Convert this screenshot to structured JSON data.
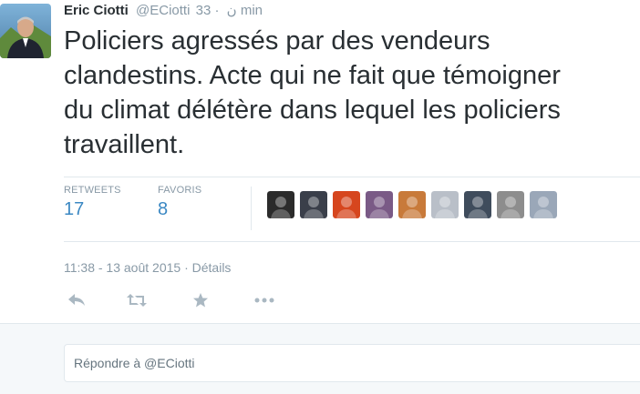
{
  "tweet": {
    "author_name": "Eric Ciotti",
    "author_handle": "@ECiotti",
    "handle_suffix": "ن",
    "time_ago": "· 33 min",
    "text_lines": [
      "Policiers agressés par des vendeurs",
      "clandestins. Acte qui ne fait que témoigner",
      "du climat délétère dans lequel les policiers",
      "travaillent."
    ]
  },
  "stats": {
    "retweets_label": "RETWEETS",
    "retweets_count": "17",
    "favorites_label": "FAVORIS",
    "favorites_count": "8"
  },
  "favoriters": [
    {
      "icon": "user-avatar",
      "color": "#2b2b2b"
    },
    {
      "icon": "user-avatar",
      "color": "#3a3f4a"
    },
    {
      "icon": "user-avatar",
      "color": "#d6461e"
    },
    {
      "icon": "user-avatar",
      "color": "#7a5a86"
    },
    {
      "icon": "user-avatar",
      "color": "#c87a3a"
    },
    {
      "icon": "user-avatar",
      "color": "#b9bfc8"
    },
    {
      "icon": "user-avatar",
      "color": "#3f4c5c"
    },
    {
      "icon": "user-avatar",
      "color": "#8d8d8d"
    },
    {
      "icon": "user-avatar",
      "color": "#9aa7b8"
    }
  ],
  "meta": {
    "timestamp": "11:38 - 13 août 2015",
    "separator": "·",
    "details_label": "Détails"
  },
  "actions": [
    {
      "name": "reply-icon"
    },
    {
      "name": "retweet-icon"
    },
    {
      "name": "favorite-icon"
    },
    {
      "name": "more-icon"
    }
  ],
  "reply": {
    "placeholder": "Répondre à @ECiotti"
  },
  "colors": {
    "link_blue": "#3b88c3",
    "muted": "#8899a6",
    "icon_gray": "#aab8c2",
    "border": "#e1e8ed"
  }
}
